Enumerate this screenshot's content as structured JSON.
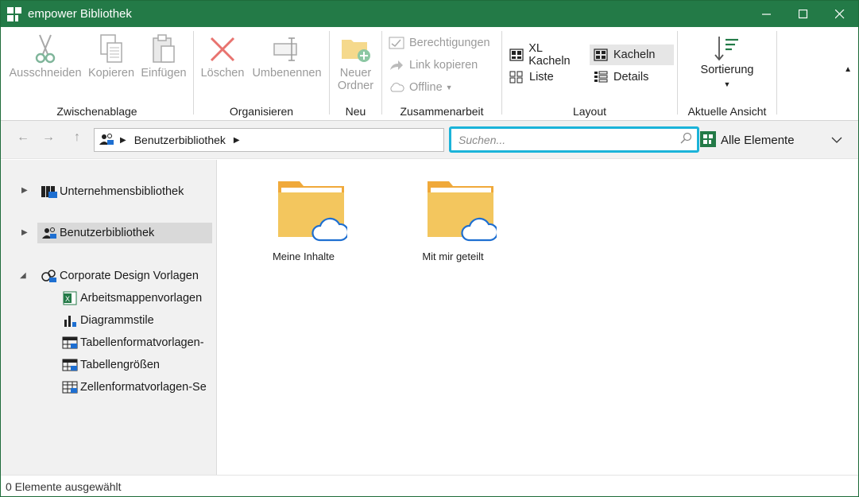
{
  "window": {
    "title": "empower Bibliothek"
  },
  "ribbon": {
    "clipboard": {
      "label": "Zwischenablage",
      "cut": "Ausschneiden",
      "copy": "Kopieren",
      "paste": "Einfügen"
    },
    "organize": {
      "label": "Organisieren",
      "delete": "Löschen",
      "rename": "Umbenennen"
    },
    "new": {
      "label": "Neu",
      "new_folder_line1": "Neuer",
      "new_folder_line2": "Ordner"
    },
    "collab": {
      "label": "Zusammenarbeit",
      "permissions": "Berechtigungen",
      "copy_link": "Link kopieren",
      "offline": "Offline"
    },
    "layout": {
      "label": "Layout",
      "xl_tiles": "XL Kacheln",
      "tiles": "Kacheln",
      "list": "Liste",
      "details": "Details",
      "selected": "tiles"
    },
    "view": {
      "label": "Aktuelle Ansicht",
      "sort": "Sortierung"
    }
  },
  "address": {
    "crumb": "Benutzerbibliothek"
  },
  "search": {
    "placeholder": "Suchen..."
  },
  "filter": {
    "selected": "Alle Elemente"
  },
  "tree": {
    "items": [
      {
        "label": "Unternehmensbibliothek"
      },
      {
        "label": "Benutzerbibliothek"
      },
      {
        "label": "Corporate Design Vorlagen"
      }
    ],
    "children": [
      {
        "label": "Arbeitsmappenvorlagen"
      },
      {
        "label": "Diagrammstile"
      },
      {
        "label": "Tabellenformatvorlagen-"
      },
      {
        "label": "Tabellengrößen"
      },
      {
        "label": "Zellenformatvorlagen-Se"
      }
    ]
  },
  "content": {
    "tiles": [
      {
        "label": "Meine Inhalte"
      },
      {
        "label": "Mit mir geteilt"
      }
    ]
  },
  "status": {
    "text": "0 Elemente ausgewählt"
  },
  "colors": {
    "titlebar": "#237a47",
    "search_focus": "#1bb3d9",
    "folder": "#f3c65e",
    "cloud": "#1e6fd1"
  }
}
